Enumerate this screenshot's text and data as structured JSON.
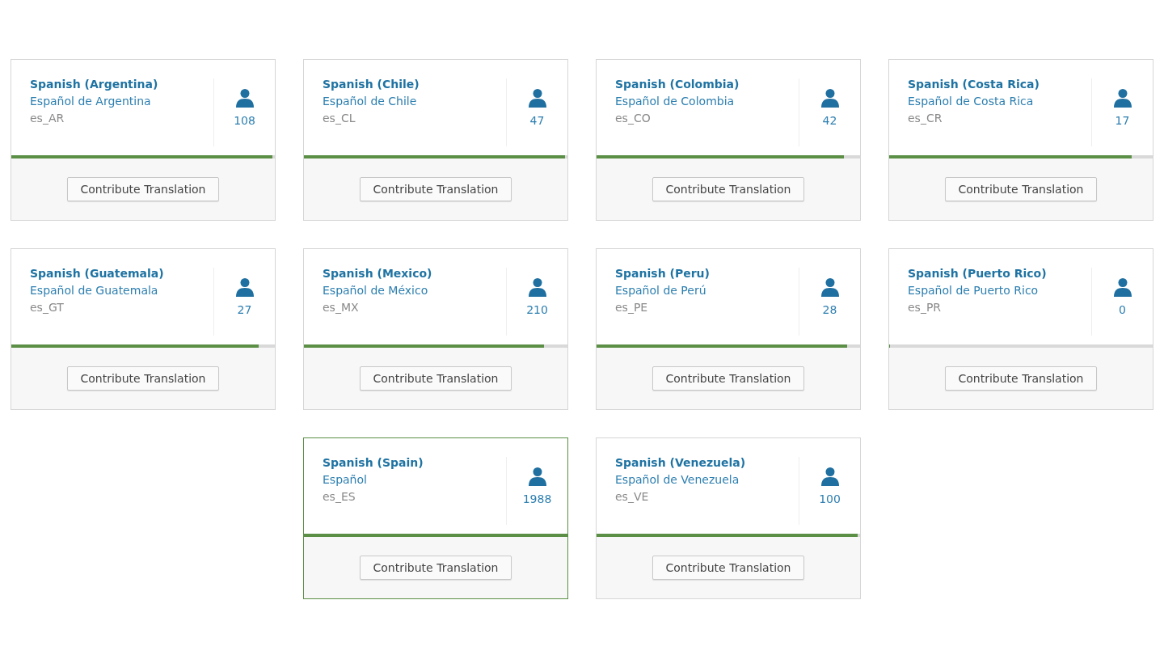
{
  "languages": [
    {
      "name": "Spanish (Argentina)",
      "native": "Español de Argentina",
      "code": "es_AR",
      "count": "108",
      "level": 0.99,
      "selected": false,
      "button": "Contribute Translation"
    },
    {
      "name": "Spanish (Chile)",
      "native": "Español de Chile",
      "code": "es_CL",
      "count": "47",
      "level": 0.99,
      "selected": false,
      "button": "Contribute Translation"
    },
    {
      "name": "Spanish (Colombia)",
      "native": "Español de Colombia",
      "code": "es_CO",
      "count": "42",
      "level": 0.94,
      "selected": false,
      "button": "Contribute Translation"
    },
    {
      "name": "Spanish (Costa Rica)",
      "native": "Español de Costa Rica",
      "code": "es_CR",
      "count": "17",
      "level": 0.92,
      "selected": false,
      "button": "Contribute Translation"
    },
    {
      "name": "Spanish (Guatemala)",
      "native": "Español de Guatemala",
      "code": "es_GT",
      "count": "27",
      "level": 0.94,
      "selected": false,
      "button": "Contribute Translation"
    },
    {
      "name": "Spanish (Mexico)",
      "native": "Español de México",
      "code": "es_MX",
      "count": "210",
      "level": 0.91,
      "selected": false,
      "button": "Contribute Translation"
    },
    {
      "name": "Spanish (Peru)",
      "native": "Español de Perú",
      "code": "es_PE",
      "count": "28",
      "level": 0.95,
      "selected": false,
      "button": "Contribute Translation"
    },
    {
      "name": "Spanish (Puerto Rico)",
      "native": "Español de Puerto Rico",
      "code": "es_PR",
      "count": "0",
      "level": 0,
      "selected": false,
      "button": "Contribute Translation"
    },
    {
      "name": "Spanish (Spain)",
      "native": "Español",
      "code": "es_ES",
      "count": "1988",
      "level": 1,
      "selected": true,
      "button": "Contribute Translation"
    },
    {
      "name": "Spanish (Venezuela)",
      "native": "Español de Venezuela",
      "code": "es_VE",
      "count": "100",
      "level": 0.99,
      "selected": false,
      "button": "Contribute Translation"
    }
  ]
}
